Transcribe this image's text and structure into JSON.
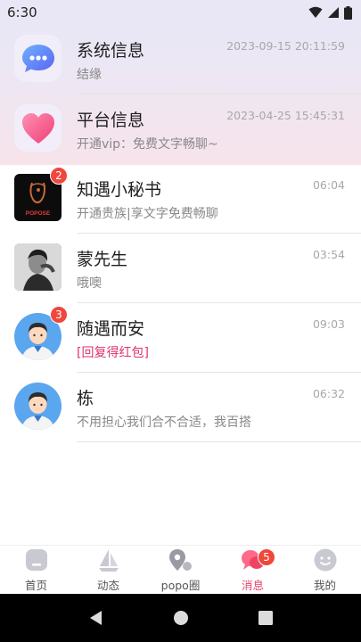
{
  "status_bar": {
    "time": "6:30"
  },
  "messages": [
    {
      "title": "系统信息",
      "subtitle": "结缘",
      "time": "2023-09-15 20:11:59",
      "badge": ""
    },
    {
      "title": "平台信息",
      "subtitle": "开通vip：免费文字畅聊~",
      "time": "2023-04-25 15:45:31",
      "badge": ""
    },
    {
      "title": "知遇小秘书",
      "subtitle": "开通贵族|享文字免费畅聊",
      "time": "06:04",
      "badge": "2",
      "logo_text": "POPOSE"
    },
    {
      "title": "蒙先生",
      "subtitle": "哦噢",
      "time": "03:54",
      "badge": ""
    },
    {
      "title": "随遇而安",
      "subtitle": "[回复得红包]",
      "time": "09:03",
      "badge": "3"
    },
    {
      "title": "栋",
      "subtitle": "不用担心我们合不合适，我百搭",
      "time": "06:32",
      "badge": ""
    }
  ],
  "tabs": [
    {
      "label": "首页",
      "icon": "home-icon"
    },
    {
      "label": "动态",
      "icon": "sailboat-icon"
    },
    {
      "label": "popo圈",
      "icon": "location-pin-icon"
    },
    {
      "label": "消息",
      "icon": "chat-bubble-icon",
      "badge": "5",
      "active": true
    },
    {
      "label": "我的",
      "icon": "smiley-icon"
    }
  ],
  "colors": {
    "accent": "#e8416c",
    "badge": "#f0473c",
    "subtitle_highlight": "#e0306b"
  }
}
